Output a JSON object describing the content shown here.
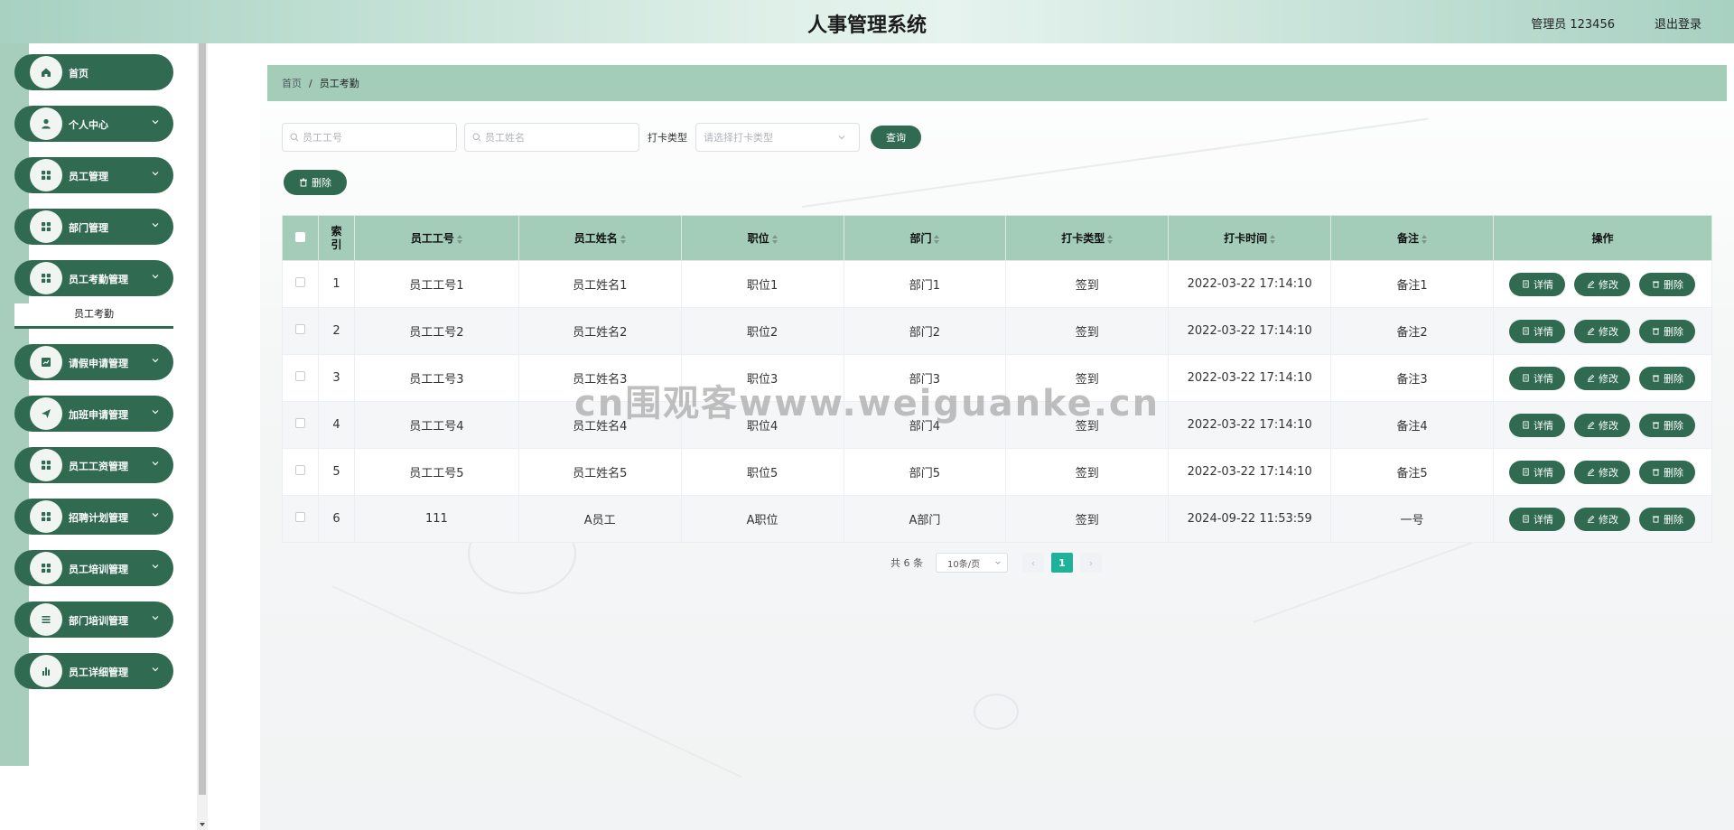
{
  "header": {
    "title": "人事管理系统",
    "user": "管理员 123456",
    "logout": "退出登录"
  },
  "sidebar": {
    "items": [
      {
        "label": "首页",
        "icon": "home-icon",
        "has_arrow": false
      },
      {
        "label": "个人中心",
        "icon": "user-icon",
        "has_arrow": true
      },
      {
        "label": "员工管理",
        "icon": "grid-icon",
        "has_arrow": true
      },
      {
        "label": "部门管理",
        "icon": "grid-icon",
        "has_arrow": true
      },
      {
        "label": "员工考勤管理",
        "icon": "grid-icon",
        "has_arrow": true,
        "expanded": true,
        "sub": "员工考勤"
      },
      {
        "label": "请假申请管理",
        "icon": "chart-box-icon",
        "has_arrow": true
      },
      {
        "label": "加班申请管理",
        "icon": "send-icon",
        "has_arrow": true
      },
      {
        "label": "员工工资管理",
        "icon": "grid-icon",
        "has_arrow": true
      },
      {
        "label": "招聘计划管理",
        "icon": "grid-icon",
        "has_arrow": true
      },
      {
        "label": "员工培训管理",
        "icon": "grid-icon",
        "has_arrow": true
      },
      {
        "label": "部门培训管理",
        "icon": "list-icon",
        "has_arrow": true
      },
      {
        "label": "员工详细管理",
        "icon": "bar-chart-icon",
        "has_arrow": true
      }
    ]
  },
  "breadcrumb": {
    "home": "首页",
    "sep": "/",
    "current": "员工考勤"
  },
  "search": {
    "emp_no_placeholder": "员工工号",
    "emp_name_placeholder": "员工姓名",
    "type_label": "打卡类型",
    "type_placeholder": "请选择打卡类型",
    "query": "查询"
  },
  "actions": {
    "delete": "删除"
  },
  "table": {
    "headers": [
      "索引",
      "员工工号",
      "员工姓名",
      "职位",
      "部门",
      "打卡类型",
      "打卡时间",
      "备注",
      "操作"
    ],
    "rows": [
      [
        "1",
        "员工工号1",
        "员工姓名1",
        "职位1",
        "部门1",
        "签到",
        "2022-03-22 17:14:10",
        "备注1"
      ],
      [
        "2",
        "员工工号2",
        "员工姓名2",
        "职位2",
        "部门2",
        "签到",
        "2022-03-22 17:14:10",
        "备注2"
      ],
      [
        "3",
        "员工工号3",
        "员工姓名3",
        "职位3",
        "部门3",
        "签到",
        "2022-03-22 17:14:10",
        "备注3"
      ],
      [
        "4",
        "员工工号4",
        "员工姓名4",
        "职位4",
        "部门4",
        "签到",
        "2022-03-22 17:14:10",
        "备注4"
      ],
      [
        "5",
        "员工工号5",
        "员工姓名5",
        "职位5",
        "部门5",
        "签到",
        "2022-03-22 17:14:10",
        "备注5"
      ],
      [
        "6",
        "111",
        "A员工",
        "A职位",
        "A部门",
        "签到",
        "2024-09-22 11:53:59",
        "一号"
      ]
    ],
    "op_detail": "详情",
    "op_edit": "修改",
    "op_delete": "删除"
  },
  "pager": {
    "total": "共 6 条",
    "size": "10条/页",
    "prev": "‹",
    "page": "1",
    "next": "›"
  },
  "watermark": "cn围观客www.weiguanke.cn",
  "colors": {
    "primary": "#2f6a51",
    "header_bg": "#a3cdb9",
    "page_active": "#1fb19a"
  }
}
